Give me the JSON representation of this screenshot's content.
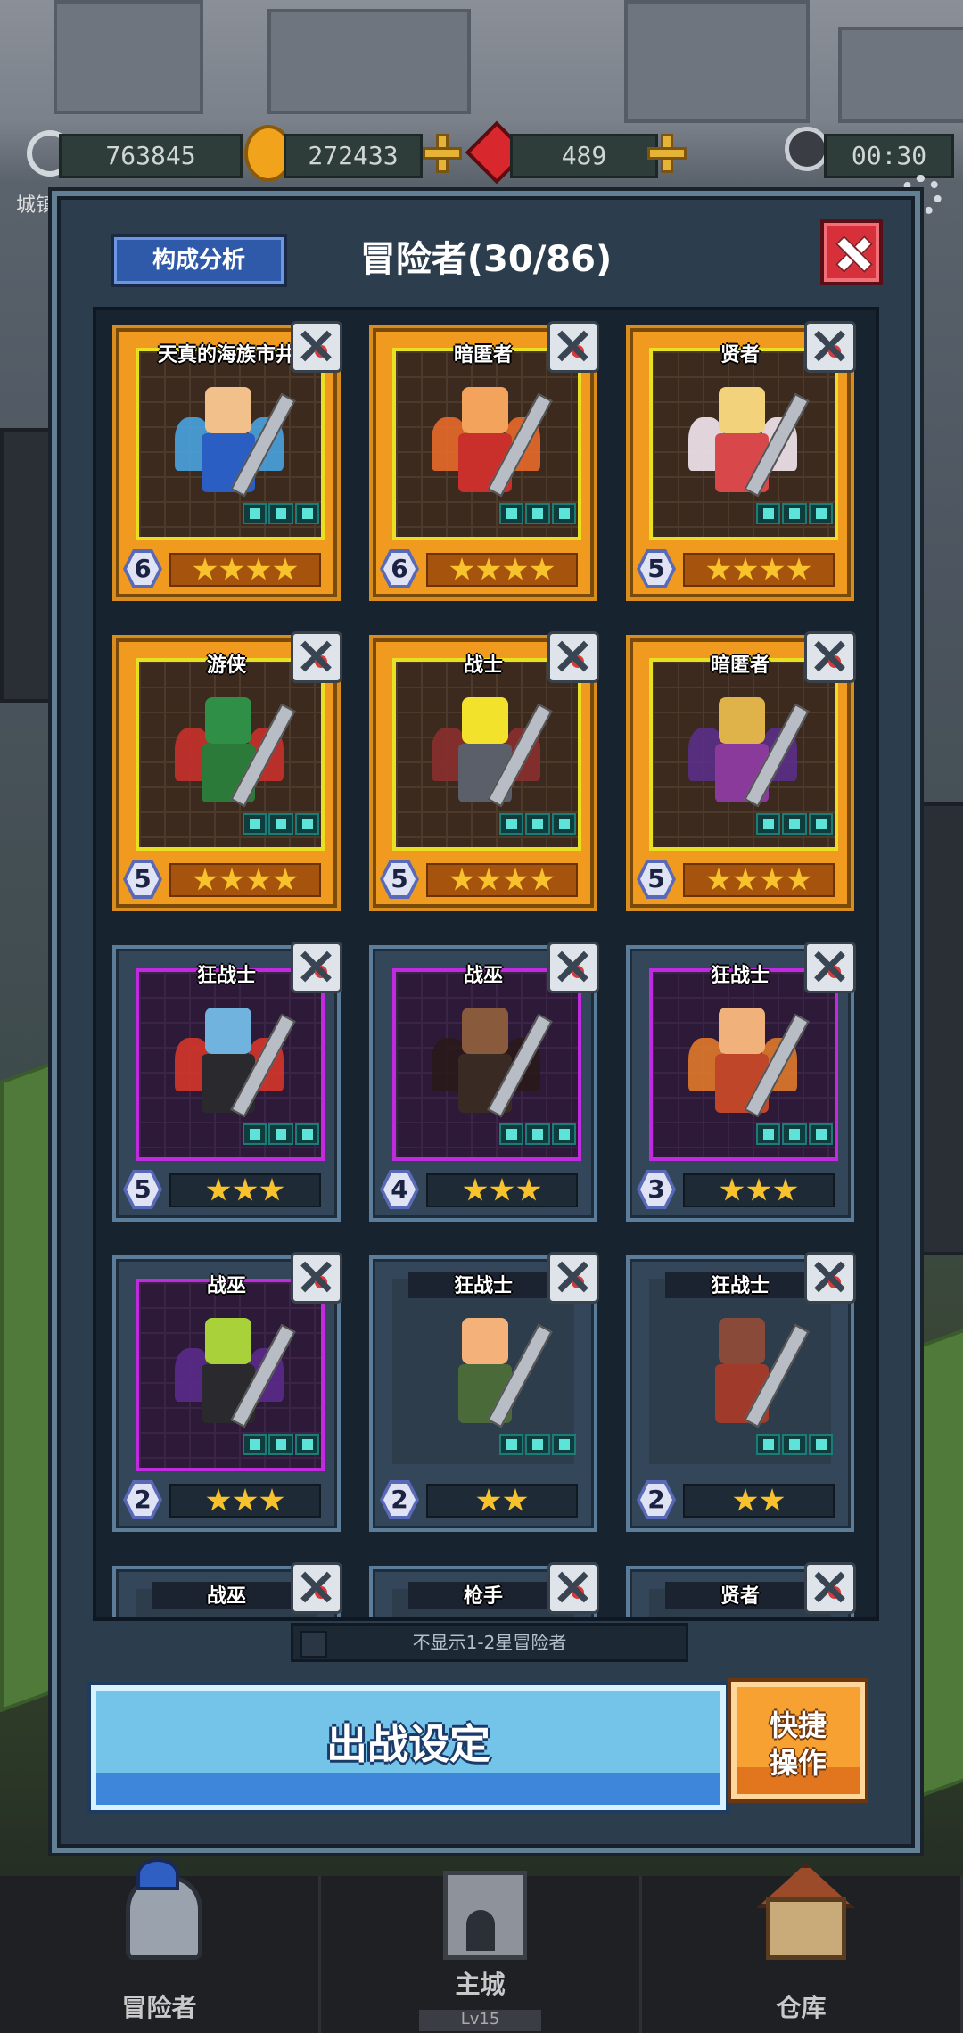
{
  "resources": {
    "sword_value": "763845",
    "coin_value": "272433",
    "gem_value": "489",
    "timer": "00:30",
    "city_label": "城镇"
  },
  "modal": {
    "analysis_button": "构成分析",
    "title": "冒险者(30/86)",
    "toggle_label": "不显示1-2星冒险者",
    "deploy_button": "出战设定",
    "quick_button_line1": "快捷",
    "quick_button_line2": "操作"
  },
  "cards": [
    {
      "name": "天真的海族市井",
      "level": "6",
      "stars": 4,
      "frame": "gold",
      "head": "#f2c08a",
      "body": "#2a5ec2",
      "wing": "#4aa3e0"
    },
    {
      "name": "暗匿者",
      "level": "6",
      "stars": 4,
      "frame": "gold",
      "head": "#f4a35c",
      "body": "#c9302c",
      "wing": "#e86a2a"
    },
    {
      "name": "贤者",
      "level": "5",
      "stars": 4,
      "frame": "gold",
      "head": "#f3d27c",
      "body": "#d8484a",
      "wing": "#f4e7ef"
    },
    {
      "name": "游侠",
      "level": "5",
      "stars": 4,
      "frame": "gold",
      "head": "#2f8f46",
      "body": "#2c7a3a",
      "wing": "#c8302c"
    },
    {
      "name": "战士",
      "level": "5",
      "stars": 4,
      "frame": "gold",
      "head": "#f2e22c",
      "body": "#5a5f69",
      "wing": "#8a2f2f"
    },
    {
      "name": "暗匿者",
      "level": "5",
      "stars": 4,
      "frame": "gold",
      "head": "#e0b24a",
      "body": "#8a3a9a",
      "wing": "#5b2f8a"
    },
    {
      "name": "狂战士",
      "level": "5",
      "stars": 3,
      "frame": "purple",
      "head": "#6fb3de",
      "body": "#2a2a2e",
      "wing": "#d4362a"
    },
    {
      "name": "战巫",
      "level": "4",
      "stars": 3,
      "frame": "purple",
      "head": "#8a5a3c",
      "body": "#3a2a24",
      "wing": "#2a1a1a"
    },
    {
      "name": "狂战士",
      "level": "3",
      "stars": 3,
      "frame": "purple",
      "head": "#f0b27a",
      "body": "#c0462a",
      "wing": "#e07a2a"
    },
    {
      "name": "战巫",
      "level": "2",
      "stars": 3,
      "frame": "purple",
      "head": "#a9d23a",
      "body": "#2a2a2e",
      "wing": "#5a2a8a"
    },
    {
      "name": "狂战士",
      "level": "2",
      "stars": 2,
      "frame": "plain",
      "head": "#f4b27a",
      "body": "#4a6a3a",
      "wing": "transparent"
    },
    {
      "name": "狂战士",
      "level": "2",
      "stars": 2,
      "frame": "plain",
      "head": "#8a4a3a",
      "body": "#a03a2a",
      "wing": "transparent"
    },
    {
      "name": "战巫",
      "level": "",
      "stars": 0,
      "frame": "plain",
      "head": "transparent",
      "body": "transparent",
      "wing": "transparent"
    },
    {
      "name": "枪手",
      "level": "",
      "stars": 0,
      "frame": "plain",
      "head": "transparent",
      "body": "transparent",
      "wing": "transparent"
    },
    {
      "name": "贤者",
      "level": "",
      "stars": 0,
      "frame": "plain",
      "head": "transparent",
      "body": "transparent",
      "wing": "transparent"
    }
  ],
  "nav": [
    {
      "label": "冒险者",
      "icon": "knight-helmet-icon"
    },
    {
      "label": "主城",
      "icon": "castle-icon",
      "sub": "Lv15"
    },
    {
      "label": "仓库",
      "icon": "warehouse-icon"
    }
  ]
}
